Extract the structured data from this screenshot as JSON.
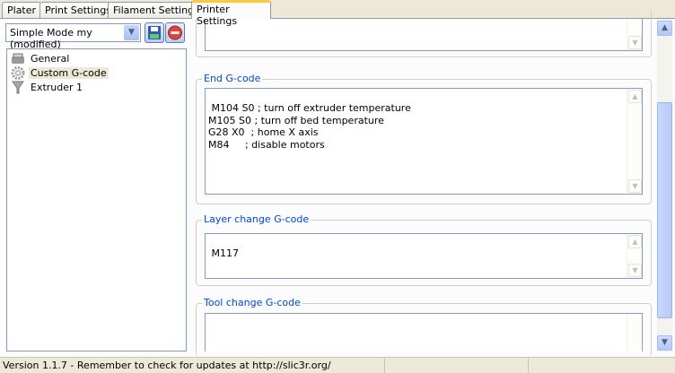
{
  "tabs": [
    {
      "label": "Plater"
    },
    {
      "label": "Print Settings"
    },
    {
      "label": "Filament Settings"
    },
    {
      "label": "Printer Settings",
      "active": true
    }
  ],
  "preset": {
    "value": "Simple Mode my (modified)",
    "save_icon": "save-icon",
    "delete_icon": "delete-icon"
  },
  "tree": [
    {
      "label": "General",
      "icon": "printer-icon"
    },
    {
      "label": "Custom G-code",
      "icon": "gear-icon",
      "selected": true
    },
    {
      "label": "Extruder 1",
      "icon": "funnel-icon"
    }
  ],
  "sections": {
    "end_gcode": {
      "title": "End G-code",
      "value": "M104 S0 ; turn off extruder temperature\nM105 S0 ; turn off bed temperature\nG28 X0  ; home X axis\nM84     ; disable motors"
    },
    "layer_change": {
      "title": "Layer change G-code",
      "value": "M117"
    },
    "tool_change": {
      "title": "Tool change G-code",
      "value": ""
    }
  },
  "status": {
    "text": "Version 1.1.7 - Remember to check for updates at http://slic3r.org/"
  }
}
